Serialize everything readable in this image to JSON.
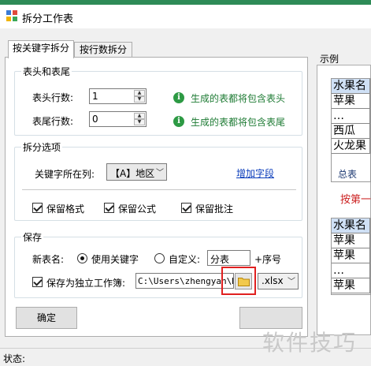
{
  "window": {
    "title": "拆分工作表",
    "accent_strip_color": "#2e8b57"
  },
  "tabs": [
    {
      "label": "按关键字拆分",
      "active": true
    },
    {
      "label": "按行数拆分",
      "active": false
    }
  ],
  "header_footer": {
    "legend": "表头和表尾",
    "header_rows_label": "表头行数:",
    "header_rows_value": "1",
    "header_hint": "生成的表都将包含表头",
    "footer_rows_label": "表尾行数:",
    "footer_rows_value": "0",
    "footer_hint": "生成的表都将包含表尾",
    "info_glyph": "i"
  },
  "split_options": {
    "legend": "拆分选项",
    "key_column_label": "关键字所在列:",
    "key_column_value": "【A】地区",
    "add_field_link": "增加字段",
    "keep_format": {
      "label": "保留格式",
      "checked": true
    },
    "keep_formula": {
      "label": "保留公式",
      "checked": true
    },
    "keep_comments": {
      "label": "保留批注",
      "checked": true
    }
  },
  "save": {
    "legend": "保存",
    "new_sheet_name_label": "新表名:",
    "use_keyword": {
      "label": "使用关键字",
      "selected": true
    },
    "custom": {
      "label": "自定义:",
      "selected": false
    },
    "custom_value": "分表",
    "suffix_label": "+序号",
    "save_as_workbook": {
      "label": "保存为独立工作簿:",
      "checked": true
    },
    "path_value": "C:\\Users\\zhengyan\\De",
    "extension_value": ".xlsx",
    "folder_icon": "folder-icon"
  },
  "buttons": {
    "confirm": "确定"
  },
  "status": {
    "label": "状态:"
  },
  "example": {
    "legend": "示例",
    "top_sheet": {
      "rows": [
        "水果名",
        "苹果",
        "…",
        "西瓜",
        "火龙果"
      ],
      "tab_label": "总表"
    },
    "note": "按第一",
    "bottom_sheet": {
      "rows": [
        "水果名",
        "苹果",
        "苹果",
        "…",
        "苹果"
      ]
    }
  },
  "watermark": "软件技巧"
}
